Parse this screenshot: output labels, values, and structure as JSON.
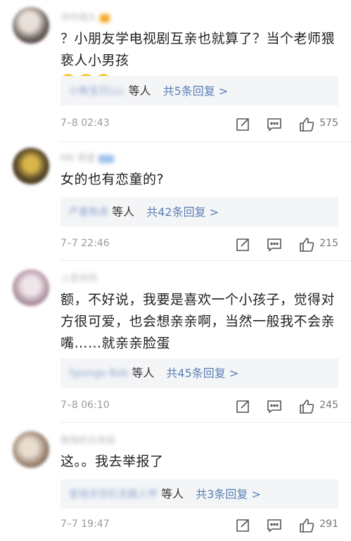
{
  "comments": [
    {
      "username": "寻你很久",
      "text": "？小朋友学电视剧互亲也就算了？当个老师猥亵人小男孩",
      "emoji_count": 3,
      "reply_names": "小熊宝贝LLL",
      "reply_etc": "等人",
      "reply_count": "共5条回复 >",
      "timestamp": "7–8 02:43",
      "likes": "575"
    },
    {
      "username": "MK 零度",
      "text": "女的也有恋童的?",
      "reply_names": "严重焦虑",
      "reply_etc": "等人",
      "reply_count": "共42条回复 >",
      "timestamp": "7–7 22:46",
      "likes": "215"
    },
    {
      "username": "上官炜玥",
      "text": "额，不好说，我要是喜欢一个小孩子，觉得对方很可爱，也会想亲亲啊，当然一般我不会亲嘴……就亲亲脸蛋",
      "reply_names": "Sponge Bob",
      "reply_etc": "等人",
      "reply_count": "共45条回复 >",
      "timestamp": "7–8 06:10",
      "likes": "245"
    },
    {
      "username": "敖晓的日来临",
      "text": "这。。我去举报了",
      "reply_names": "爱地天空红无路人甲",
      "reply_etc": "等人",
      "reply_count": "共3条回复 >",
      "timestamp": "7–7 19:47",
      "likes": "291"
    }
  ],
  "icons": [
    "forward-icon",
    "comment-icon",
    "like-icon"
  ],
  "colors": {
    "link": "#5a7fb6",
    "meta": "#9a9a9a",
    "reply_bg": "#f4f5f7"
  }
}
